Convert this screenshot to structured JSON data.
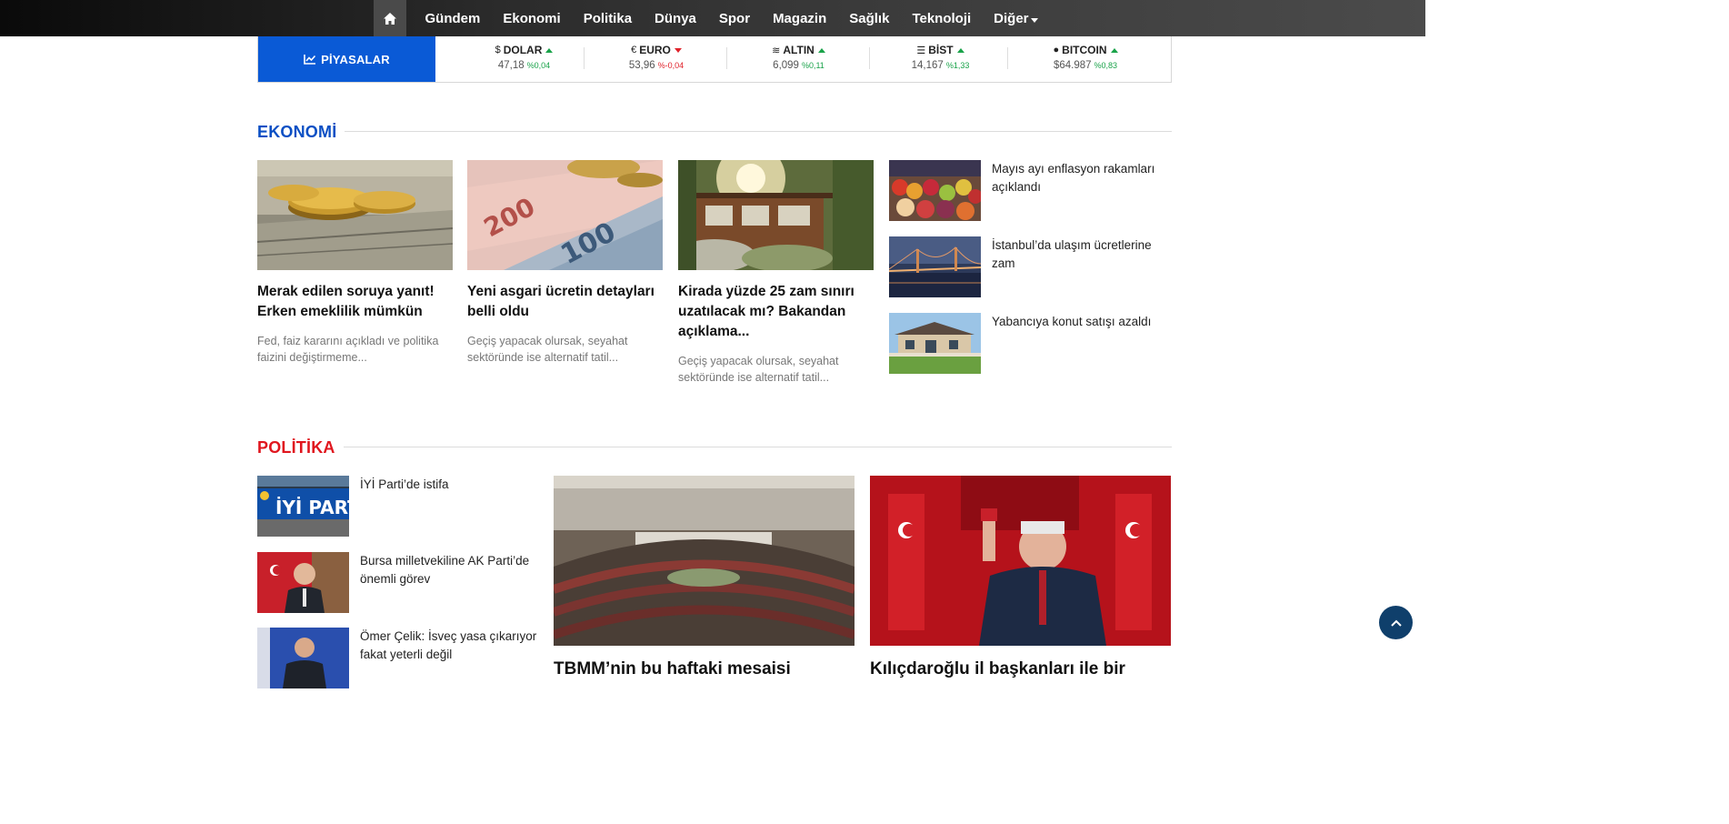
{
  "nav": {
    "items": [
      "Gündem",
      "Ekonomi",
      "Politika",
      "Dünya",
      "Spor",
      "Magazin",
      "Sağlık",
      "Teknoloji",
      "Diğer"
    ]
  },
  "markets": {
    "label": "PİYASALAR",
    "tickers": [
      {
        "symbol": "$",
        "name": "DOLAR",
        "value": "47,18",
        "change": "%0,04",
        "direction": "up"
      },
      {
        "symbol": "€",
        "name": "EURO",
        "value": "53,96",
        "change": "%-0,04",
        "direction": "down"
      },
      {
        "symbol": "≋",
        "name": "ALTIN",
        "value": "6,099",
        "change": "%0,11",
        "direction": "up"
      },
      {
        "symbol": "☰",
        "name": "BİST",
        "value": "14,167",
        "change": "%1,33",
        "direction": "up"
      },
      {
        "symbol": "●",
        "name": "BITCOIN",
        "value": "$64.987",
        "change": "%0,83",
        "direction": "up"
      }
    ]
  },
  "ekonomi": {
    "title": "EKONOMİ",
    "cards": [
      {
        "title": "Merak edilen soruya yanıt! Erken emeklilik mümkün",
        "desc": "Fed, faiz kararını açıkladı ve politika faizini değiştirmeme..."
      },
      {
        "title": "Yeni asgari ücretin detayları belli oldu",
        "desc": "Geçiş yapacak olursak, seyahat sektöründe ise alternatif tatil..."
      },
      {
        "title": "Kirada yüzde 25 zam sınırı uzatılacak mı? Bakandan açıklama...",
        "desc": "Geçiş yapacak olursak, seyahat sektöründe ise alternatif tatil..."
      }
    ],
    "side": [
      {
        "title": "Mayıs ayı enflasyon rakamları açıklandı"
      },
      {
        "title": "İstanbul’da ulaşım ücretlerine zam"
      },
      {
        "title": "Yabancıya konut satışı azaldı"
      }
    ]
  },
  "politika": {
    "title": "POLİTİKA",
    "side": [
      {
        "title": "İYİ Parti’de istifa",
        "logo_text": "İYİ PART"
      },
      {
        "title": "Bursa milletvekiline AK Parti’de önemli görev"
      },
      {
        "title": "Ömer Çelik: İsveç yasa çıkarıyor fakat yeterli değil"
      }
    ],
    "big": [
      {
        "title": "TBMM’nin bu haftaki mesaisi"
      },
      {
        "title": "Kılıçdaroğlu il başkanları ile bir"
      }
    ]
  },
  "colors": {
    "ekonomi_accent": "#0a4fc4",
    "politika_accent": "#e0161e",
    "markets_label_bg": "#0a5ad6",
    "up": "#1aa34a",
    "down": "#e0222b"
  }
}
